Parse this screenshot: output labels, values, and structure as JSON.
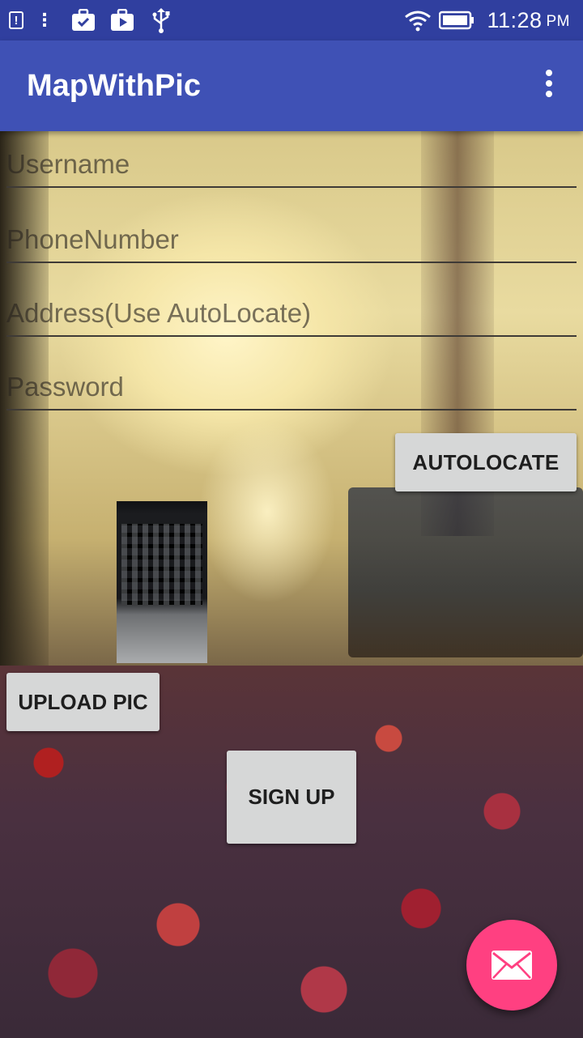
{
  "status_bar": {
    "icons": [
      "alert-icon",
      "more-vert-icon",
      "briefcase-check-icon",
      "play-store-icon",
      "usb-icon",
      "wifi-icon",
      "battery-icon"
    ],
    "time": "11:28",
    "ampm": "PM"
  },
  "app_bar": {
    "title": "MapWithPic",
    "overflow_icon": "more-vert-icon"
  },
  "form": {
    "username_placeholder": "Username",
    "phone_placeholder": "PhoneNumber",
    "address_placeholder": "Address(Use AutoLocate)",
    "password_placeholder": "Password",
    "autolocate_label": "AUTOLOCATE",
    "upload_label": "UPLOAD PIC",
    "signup_label": "SIGN UP"
  },
  "fab": {
    "icon": "email-icon"
  },
  "colors": {
    "status_bar": "#303f9f",
    "app_bar": "#3f51b5",
    "button": "#d6d7d7",
    "fab": "#ff4081"
  }
}
